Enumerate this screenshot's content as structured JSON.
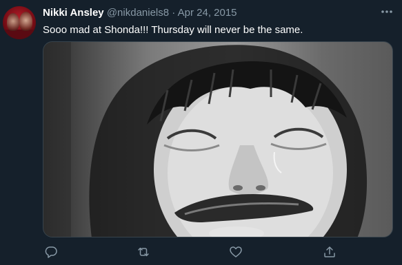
{
  "tweet": {
    "display_name": "Nikki Ansley",
    "handle": "@nikdaniels8",
    "separator": "·",
    "date": "Apr 24, 2015",
    "text": "Sooo mad at Shonda!!! Thursday will never be the same."
  },
  "icons": {
    "more": "more-horizontal-icon",
    "reply": "reply-icon",
    "retweet": "retweet-icon",
    "like": "heart-icon",
    "share": "share-icon"
  },
  "colors": {
    "background": "#15202b",
    "secondary_text": "#8899a6",
    "primary_text": "#ffffff",
    "border": "#38444d"
  }
}
